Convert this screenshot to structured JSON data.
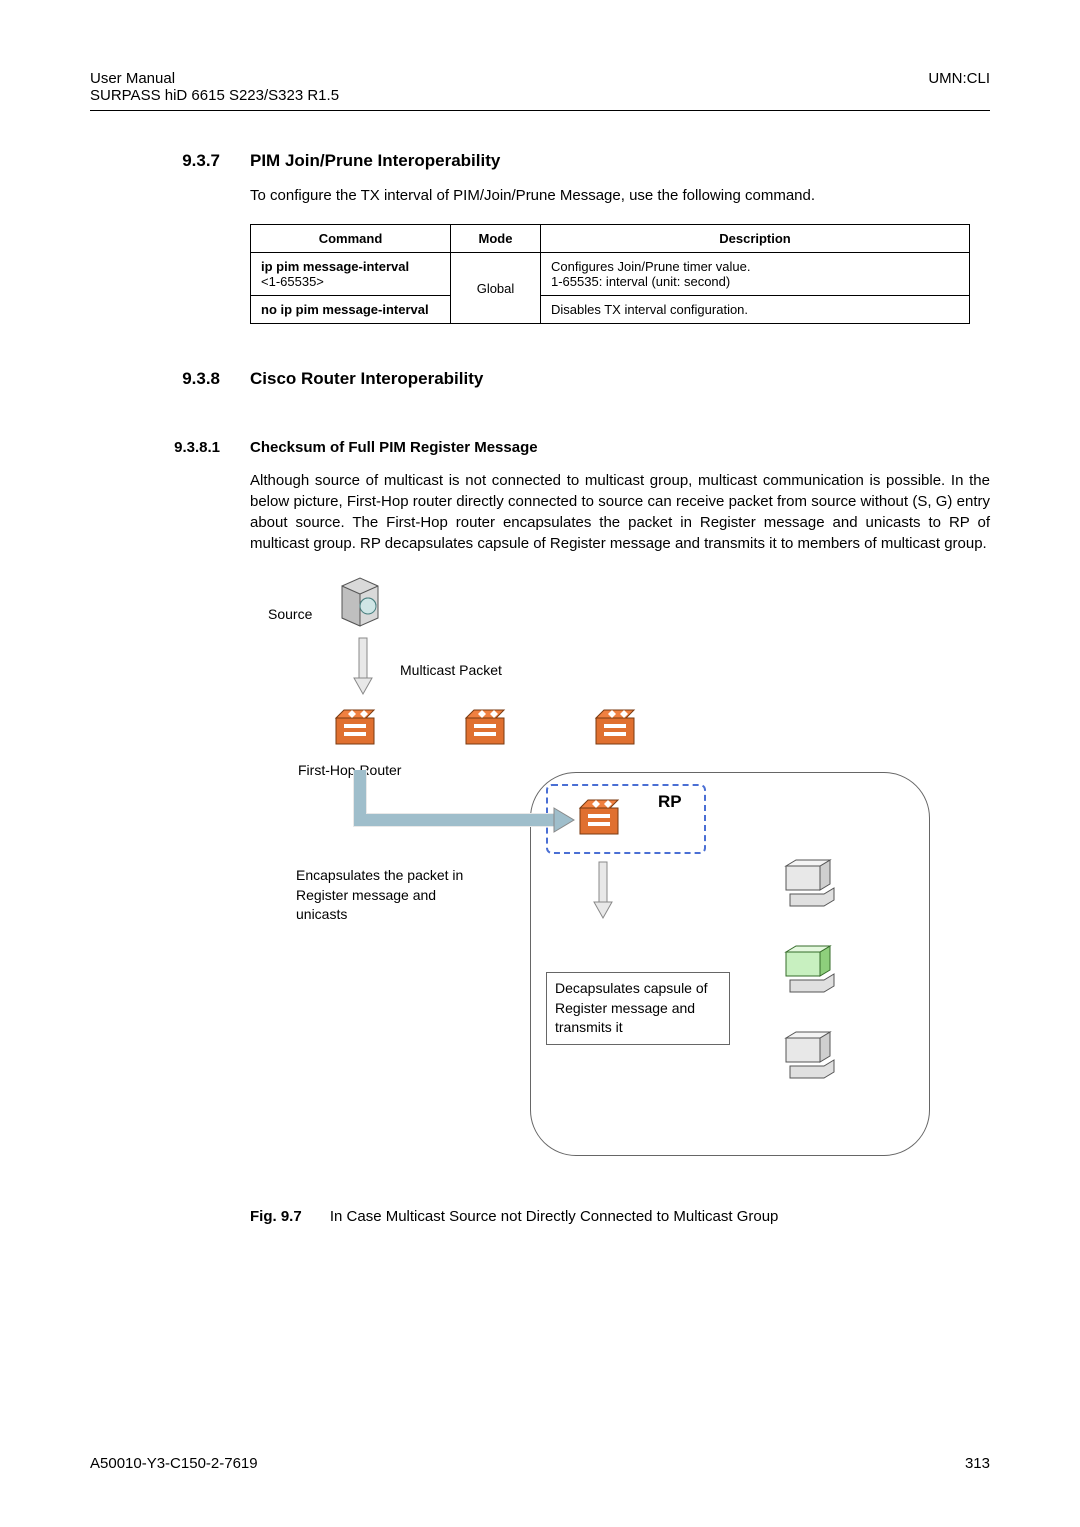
{
  "header": {
    "left_line1": "User  Manual",
    "left_line2": "SURPASS hiD 6615 S223/S323 R1.5",
    "right": "UMN:CLI"
  },
  "sec937": {
    "num": "9.3.7",
    "title": "PIM Join/Prune Interoperability",
    "intro": "To configure the TX interval of PIM/Join/Prune Message, use the following command."
  },
  "table": {
    "head": {
      "c1": "Command",
      "c2": "Mode",
      "c3": "Description"
    },
    "rows": [
      {
        "cmd_l1": "ip pim message-interval",
        "cmd_l2": "<1-65535>",
        "desc_l1": "Configures Join/Prune timer value.",
        "desc_l2": "1-65535: interval (unit: second)"
      },
      {
        "cmd": "no ip pim message-interval",
        "desc": "Disables TX interval configuration."
      }
    ],
    "mode": "Global"
  },
  "sec938": {
    "num": "9.3.8",
    "title": "Cisco Router Interoperability"
  },
  "sec9381": {
    "num": "9.3.8.1",
    "title": "Checksum of Full PIM Register Message",
    "para": "Although source of multicast is not connected to multicast group, multicast communication is possible. In the below picture, First-Hop router directly connected to source can receive packet from source without (S, G) entry about source. The First-Hop router encapsulates the packet in Register message and unicasts to RP of multicast group. RP decapsulates capsule of Register message and transmits it to members of multicast group."
  },
  "diagram": {
    "source": "Source",
    "mpacket": "Multicast Packet",
    "fhr": "First-Hop Router",
    "rp": "RP",
    "encap": "Encapsulates the packet in Register message and unicasts",
    "decap": "Decapsulates capsule of Register message and transmits it"
  },
  "figure": {
    "label": "Fig. 9.7",
    "caption": "In Case Multicast Source not Directly Connected to Multicast Group"
  },
  "footer": {
    "left": "A50010-Y3-C150-2-7619",
    "right": "313"
  }
}
